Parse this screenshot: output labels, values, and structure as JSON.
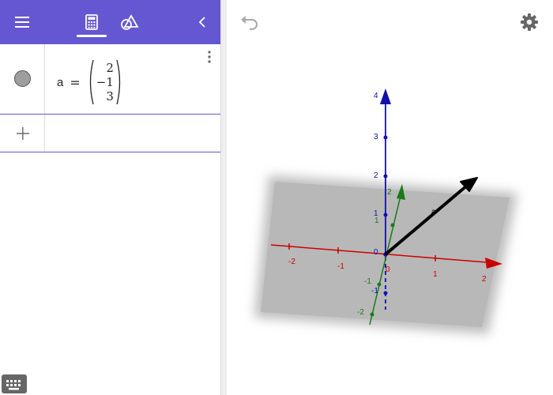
{
  "toolbar": {
    "menu_icon": "hamburger-menu-icon",
    "calculator_icon": "calculator-icon",
    "geometry_icon": "geometry-tools-icon",
    "collapse_icon": "chevron-left-icon",
    "color": "#6557d2"
  },
  "algebra": {
    "entries": [
      {
        "name": "a",
        "equals": "=",
        "vector": [
          "2",
          "−1",
          "3"
        ]
      }
    ],
    "add_icon": "plus-icon",
    "marble_color": "#9e9e9e"
  },
  "graphics": {
    "undo_icon": "undo-icon",
    "settings_icon": "gear-icon",
    "vector_label": "a",
    "axes": {
      "x": {
        "color": "#cc0000",
        "ticks": [
          "-2",
          "-1",
          "0",
          "1",
          "2"
        ]
      },
      "y": {
        "color": "#1a7a1a",
        "ticks": [
          "-2",
          "-1",
          "1",
          "2"
        ]
      },
      "z": {
        "color": "#1010b0",
        "ticks": [
          "-1",
          "1",
          "2",
          "3",
          "4"
        ]
      }
    }
  }
}
